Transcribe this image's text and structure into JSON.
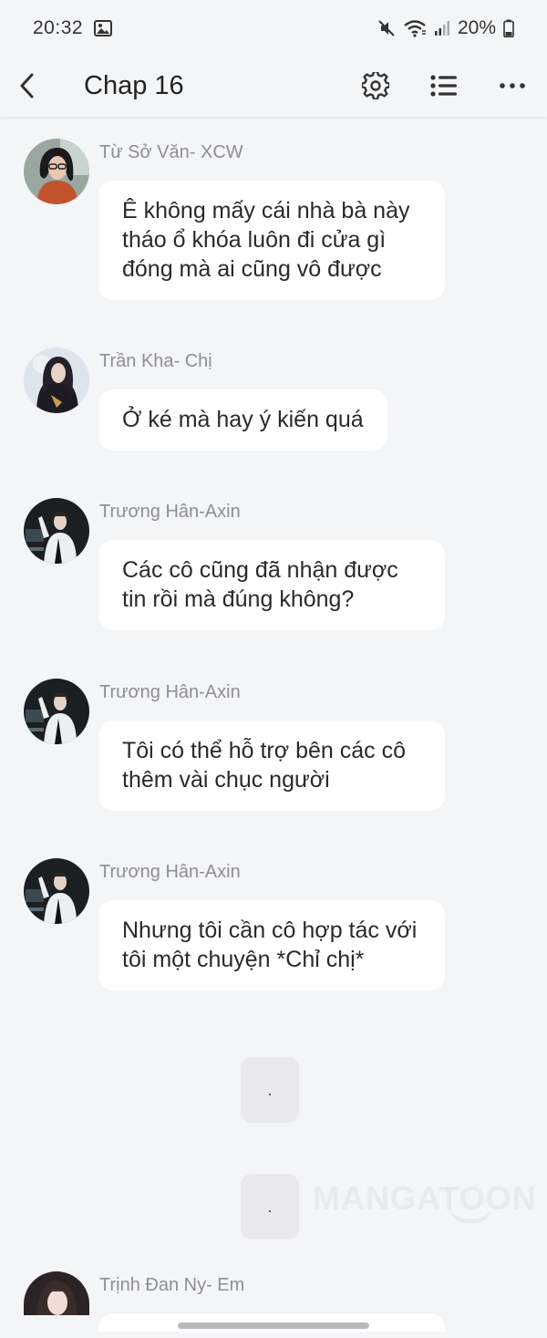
{
  "status_bar": {
    "time": "20:32",
    "battery": "20%",
    "icons": [
      "image-icon",
      "mute-icon",
      "wifi-icon",
      "signal-icon",
      "battery-icon"
    ]
  },
  "header": {
    "back_icon": "chevron-left-icon",
    "title": "Chap 16",
    "actions": [
      "gear-icon",
      "list-icon",
      "more-icon"
    ]
  },
  "messages": [
    {
      "sender": "Từ Sở Văn- XCW",
      "avatar": "avatar-tu-so-van",
      "text": "Ê không mấy cái nhà bà này tháo ổ khóa luôn đi cửa gì đóng mà ai cũng vô được"
    },
    {
      "sender": "Trần Kha- Chị",
      "avatar": "avatar-tran-kha",
      "text": "Ở ké mà hay ý kiến quá"
    },
    {
      "sender": "Trương Hân-Axin",
      "avatar": "avatar-truong-han",
      "text": "Các cô cũng đã nhận được tin rồi mà đúng không?"
    },
    {
      "sender": "Trương Hân-Axin",
      "avatar": "avatar-truong-han",
      "text": "Tôi có thể hỗ trợ bên các cô thêm vài chục người"
    },
    {
      "sender": "Trương Hân-Axin",
      "avatar": "avatar-truong-han",
      "text": "Nhưng tôi cần cô hợp tác với tôi một chuyện *Chỉ chị*"
    }
  ],
  "narration": [
    ".",
    "."
  ],
  "watermark": "MANGATOON",
  "last_message": {
    "sender": "Trịnh Đan Ny- Em",
    "avatar": "avatar-trinh-dan-ny"
  }
}
